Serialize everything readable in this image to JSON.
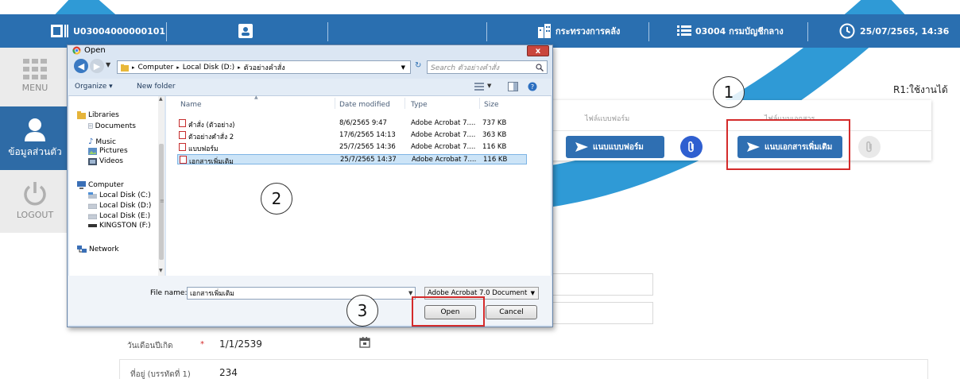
{
  "topbar": {
    "user_code": "U03004000000101",
    "ministry": "กระทรวงการคลัง",
    "department": "03004 กรมบัญชีกลาง",
    "datetime": "25/07/2565, 14:36"
  },
  "sidebar": {
    "menu_label": "MENU",
    "personal_label": "ข้อมูลส่วนตัว",
    "logout_label": "LOGOUT"
  },
  "main": {
    "status_text": "R1:ใช้งานได้",
    "attach_form_header": "ไฟล์แบบฟอร์ม",
    "attach_doc_header": "ไฟล์แนบเอกสาร",
    "attach_form_button": "แนบแบบฟอร์ม",
    "attach_doc_button": "แนบเอกสารเพิ่มเติม",
    "birthdate_label": "วันเดือนปีเกิด",
    "birthdate_value": "1/1/2539",
    "address_label": "ที่อยู่ (บรรทัดที่ 1)",
    "address_value": "234",
    "required_mark": "*"
  },
  "callouts": [
    "1",
    "2",
    "3"
  ],
  "dialog": {
    "title": "Open",
    "close_label": "x",
    "address_path": [
      "Computer",
      "Local Disk (D:)",
      "ตัวอย่างคำสั่ง"
    ],
    "search_placeholder": "Search ตัวอย่างคำสั่ง",
    "toolbar": {
      "organize": "Organize ▾",
      "new_folder": "New folder"
    },
    "tree": [
      "Libraries",
      "Documents",
      "Music",
      "Pictures",
      "Videos",
      "Computer",
      "Local Disk (C:)",
      "Local Disk (D:)",
      "Local Disk (E:)",
      "KINGSTON (F:)",
      "Network"
    ],
    "columns": [
      "Name",
      "Date modified",
      "Type",
      "Size"
    ],
    "files": [
      {
        "name": "คำสั่ง (ตัวอย่าง)",
        "date": "8/6/2565 9:47",
        "type": "Adobe Acrobat 7....",
        "size": "737 KB"
      },
      {
        "name": "ตัวอย่างคำสั่ง 2",
        "date": "17/6/2565 14:13",
        "type": "Adobe Acrobat 7....",
        "size": "363 KB"
      },
      {
        "name": "แบบฟอร์ม",
        "date": "25/7/2565 14:36",
        "type": "Adobe Acrobat 7....",
        "size": "116 KB"
      },
      {
        "name": "เอกสารเพิ่มเติม",
        "date": "25/7/2565 14:37",
        "type": "Adobe Acrobat 7....",
        "size": "116 KB"
      }
    ],
    "file_name_label": "File name:",
    "file_name_value": "เอกสารเพิ่มเติม",
    "file_type": "Adobe Acrobat 7.0 Document",
    "open_button": "Open",
    "cancel_button": "Cancel"
  },
  "colors": {
    "topbar": "#2a6fb0",
    "sidebar_active": "#2e6ba6",
    "highlight": "#d42b2b",
    "button": "#2f6fb2"
  }
}
